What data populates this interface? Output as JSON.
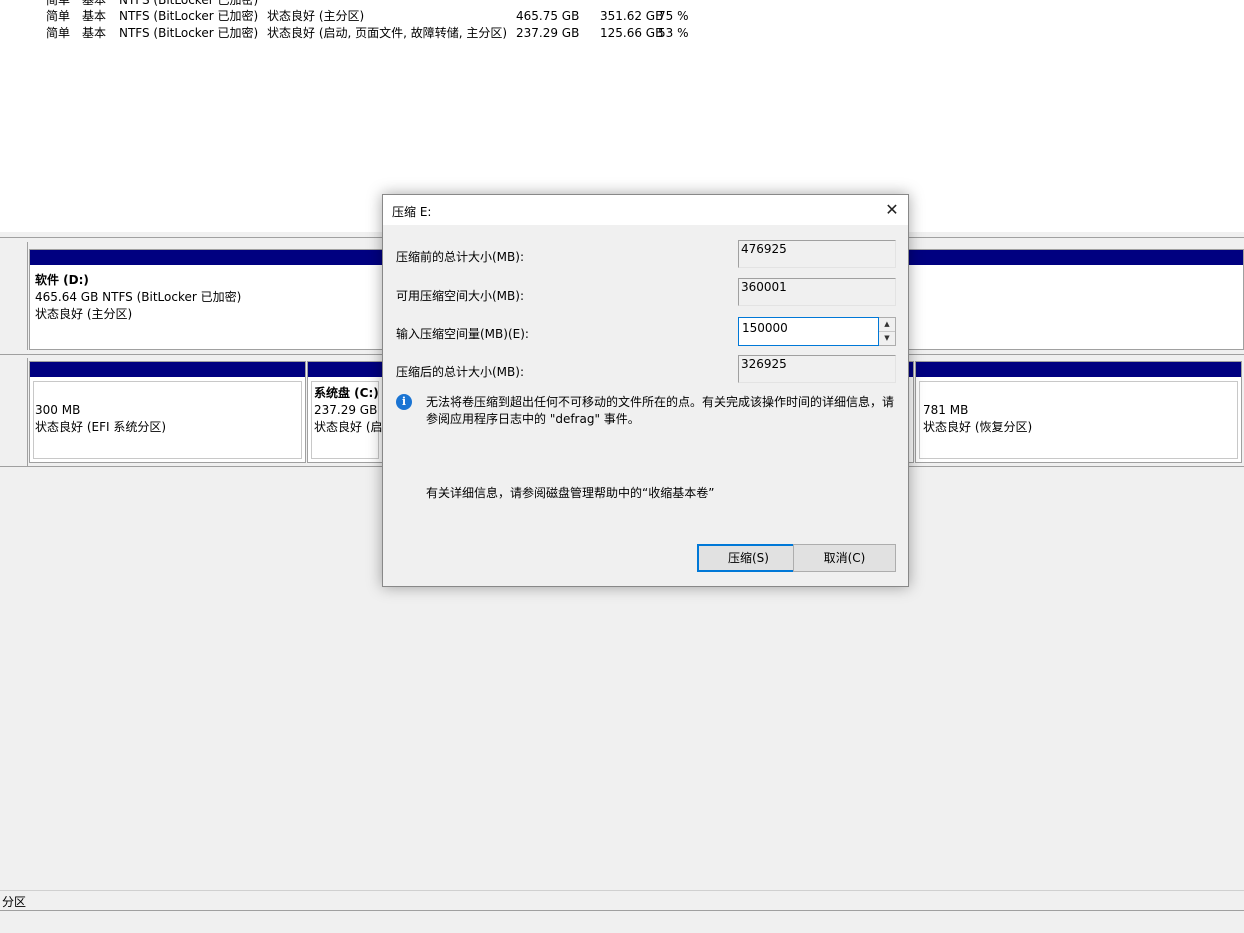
{
  "volumes": [
    {
      "layout": "简单",
      "type": "基本",
      "fs": "NTFS (BitLocker 已加密)",
      "status": "状态良好 (主分区)",
      "capacity": "465.75 GB",
      "free": "351.62 GB",
      "pct": "75 %"
    },
    {
      "layout": "简单",
      "type": "基本",
      "fs": "NTFS (BitLocker 已加密)",
      "status": "状态良好 (启动, 页面文件, 故障转储, 主分区)",
      "capacity": "237.29 GB",
      "free": "125.66 GB",
      "pct": "53 %"
    }
  ],
  "disk1": {
    "partition_d": {
      "name": "软件  (D:)",
      "detail": "465.64 GB NTFS (BitLocker 已加密)",
      "status": "状态良好 (主分区)"
    }
  },
  "disk2": {
    "efi": {
      "size": "300 MB",
      "status": "状态良好 (EFI 系统分区)"
    },
    "system": {
      "name": "系统盘  (C:)",
      "detail": "237.29 GB N",
      "status": "状态良好 (启"
    },
    "recovery": {
      "size": "781 MB",
      "status": "状态良好 (恢复分区)"
    }
  },
  "status_bar": {
    "text": "分区"
  },
  "dialog": {
    "title": "压缩 E:",
    "fields": {
      "total_before_label": "压缩前的总计大小(MB):",
      "total_before_value": "476925",
      "available_label": "可用压缩空间大小(MB):",
      "available_value": "360001",
      "input_label": "输入压缩空间量(MB)(E):",
      "input_value": "150000",
      "total_after_label": "压缩后的总计大小(MB):",
      "total_after_value": "326925"
    },
    "info_line1": "无法将卷压缩到超出任何不可移动的文件所在的点。有关完成该操作时间的详细信息，请",
    "info_line2": "参阅应用程序日志中的 \"defrag\" 事件。",
    "help_text": "有关详细信息，请参阅磁盘管理帮助中的“收缩基本卷”",
    "shrink_button": "压缩(S)",
    "cancel_button": "取消(C)"
  },
  "colors": {
    "partition_bar": "#000080",
    "accent": "#0078d7",
    "info": "#1a74d3"
  },
  "icons": {
    "close": "close-icon",
    "info": "info-icon",
    "spin_up": "spin-up-icon",
    "spin_down": "spin-down-icon"
  }
}
